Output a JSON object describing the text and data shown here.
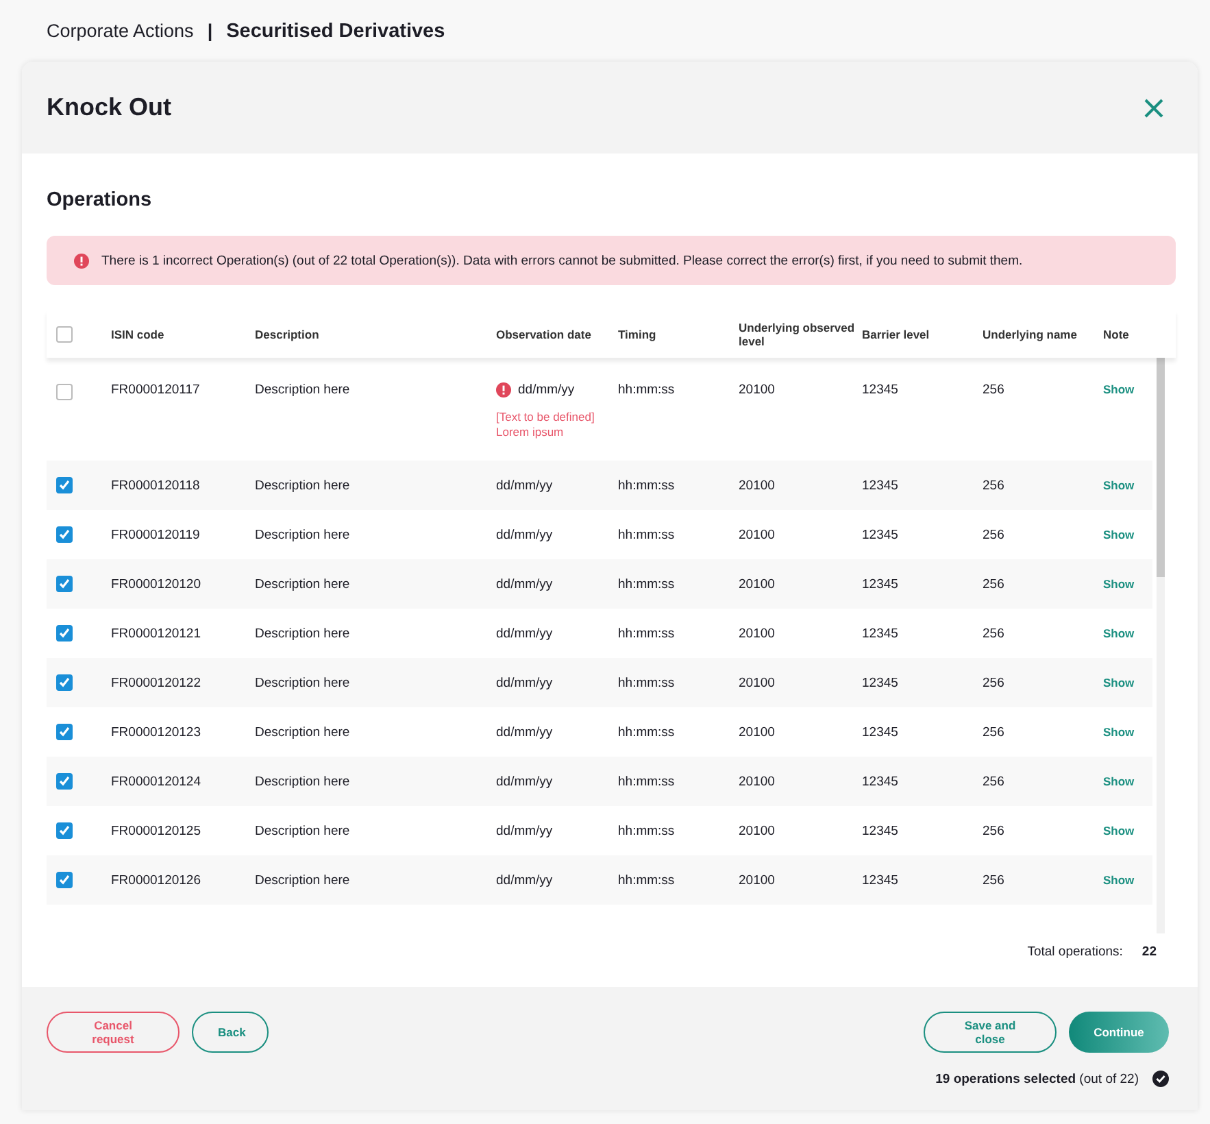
{
  "breadcrumb": {
    "parent": "Corporate Actions",
    "separator": "|",
    "current": "Securitised Derivatives"
  },
  "modal": {
    "title": "Knock Out"
  },
  "section_title": "Operations",
  "alert": {
    "message": "There is 1 incorrect Operation(s) (out of 22 total Operation(s)). Data with errors cannot be submitted. Please correct the error(s) first, if you need to submit them."
  },
  "table": {
    "select_all_checked": false,
    "columns": [
      "ISIN code",
      "Description",
      "Observation date",
      "Timing",
      "Underlying observed level",
      "Barrier level",
      "Underlying name",
      "Note"
    ],
    "rows": [
      {
        "checked": false,
        "isin": "FR0000120117",
        "description": "Description here",
        "observation_date": "dd/mm/yy",
        "timing": "hh:mm:ss",
        "underlying_observed_level": "20100",
        "barrier_level": "12345",
        "underlying_name": "256",
        "note": "Show",
        "error_lines": [
          "[Text to be defined]",
          "Lorem ipsum"
        ]
      },
      {
        "checked": true,
        "isin": "FR0000120118",
        "description": "Description here",
        "observation_date": "dd/mm/yy",
        "timing": "hh:mm:ss",
        "underlying_observed_level": "20100",
        "barrier_level": "12345",
        "underlying_name": "256",
        "note": "Show"
      },
      {
        "checked": true,
        "isin": "FR0000120119",
        "description": "Description here",
        "observation_date": "dd/mm/yy",
        "timing": "hh:mm:ss",
        "underlying_observed_level": "20100",
        "barrier_level": "12345",
        "underlying_name": "256",
        "note": "Show"
      },
      {
        "checked": true,
        "isin": "FR0000120120",
        "description": "Description here",
        "observation_date": "dd/mm/yy",
        "timing": "hh:mm:ss",
        "underlying_observed_level": "20100",
        "barrier_level": "12345",
        "underlying_name": "256",
        "note": "Show"
      },
      {
        "checked": true,
        "isin": "FR0000120121",
        "description": "Description here",
        "observation_date": "dd/mm/yy",
        "timing": "hh:mm:ss",
        "underlying_observed_level": "20100",
        "barrier_level": "12345",
        "underlying_name": "256",
        "note": "Show"
      },
      {
        "checked": true,
        "isin": "FR0000120122",
        "description": "Description here",
        "observation_date": "dd/mm/yy",
        "timing": "hh:mm:ss",
        "underlying_observed_level": "20100",
        "barrier_level": "12345",
        "underlying_name": "256",
        "note": "Show"
      },
      {
        "checked": true,
        "isin": "FR0000120123",
        "description": "Description here",
        "observation_date": "dd/mm/yy",
        "timing": "hh:mm:ss",
        "underlying_observed_level": "20100",
        "barrier_level": "12345",
        "underlying_name": "256",
        "note": "Show"
      },
      {
        "checked": true,
        "isin": "FR0000120124",
        "description": "Description here",
        "observation_date": "dd/mm/yy",
        "timing": "hh:mm:ss",
        "underlying_observed_level": "20100",
        "barrier_level": "12345",
        "underlying_name": "256",
        "note": "Show"
      },
      {
        "checked": true,
        "isin": "FR0000120125",
        "description": "Description here",
        "observation_date": "dd/mm/yy",
        "timing": "hh:mm:ss",
        "underlying_observed_level": "20100",
        "barrier_level": "12345",
        "underlying_name": "256",
        "note": "Show"
      },
      {
        "checked": true,
        "isin": "FR0000120126",
        "description": "Description here",
        "observation_date": "dd/mm/yy",
        "timing": "hh:mm:ss",
        "underlying_observed_level": "20100",
        "barrier_level": "12345",
        "underlying_name": "256",
        "note": "Show"
      }
    ]
  },
  "total": {
    "label": "Total operations:",
    "value": "22"
  },
  "buttons": {
    "cancel": "Cancel request",
    "back": "Back",
    "save": "Save and close",
    "continue": "Continue"
  },
  "selection_summary": "**19 operations selected** (out of 22)"
}
